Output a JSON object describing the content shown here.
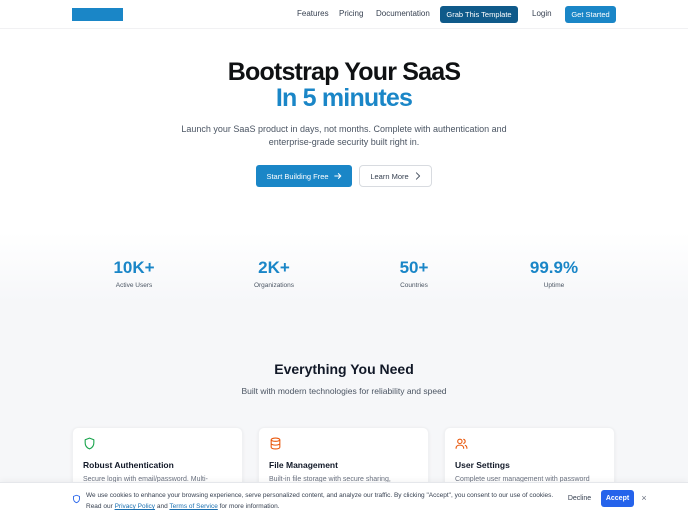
{
  "nav": {
    "links": [
      "Features",
      "Pricing",
      "Documentation"
    ],
    "grab_label": "Grab This Template",
    "login_label": "Login",
    "get_started_label": "Get Started"
  },
  "hero": {
    "title_line1": "Bootstrap Your SaaS",
    "title_line2": "In 5 minutes",
    "subtitle": "Launch your SaaS product in days, not months. Complete with authentication and enterprise-grade security built right in.",
    "primary_label": "Start Building Free",
    "secondary_label": "Learn More"
  },
  "stats": [
    {
      "value": "10K+",
      "label": "Active Users"
    },
    {
      "value": "2K+",
      "label": "Organizations"
    },
    {
      "value": "50+",
      "label": "Countries"
    },
    {
      "value": "99.9%",
      "label": "Uptime"
    }
  ],
  "features": {
    "title": "Everything You Need",
    "subtitle": "Built with modern technologies for reliability and speed",
    "cards": [
      {
        "icon": "shield-icon",
        "title": "Robust Authentication",
        "desc": "Secure login with email/password. Multi-"
      },
      {
        "icon": "database-icon",
        "title": "File Management",
        "desc": "Built-in file storage with secure sharing,"
      },
      {
        "icon": "users-icon",
        "title": "User Settings",
        "desc": "Complete user management with password"
      }
    ]
  },
  "cookie": {
    "text_line1": "We use cookies to enhance your browsing experience, serve personalized content, and analyze our traffic. By clicking \"Accept\", you consent to our use of cookies.",
    "read_our": "Read our",
    "privacy_link": "Privacy Policy",
    "and": "and",
    "terms_link": "Terms of Service",
    "tail": "for more information.",
    "decline_label": "Decline",
    "accept_label": "Accept",
    "close_label": "×"
  },
  "colors": {
    "brand": "#1a86c7",
    "brand_dark": "#0f5a8a",
    "accept": "#2563eb",
    "icon_green": "#16a34a",
    "icon_orange": "#ea580c"
  }
}
